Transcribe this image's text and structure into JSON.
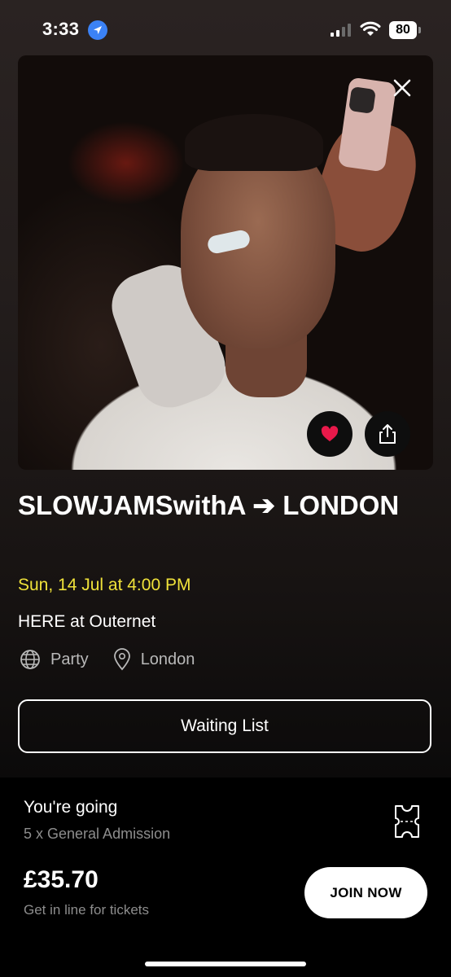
{
  "status_bar": {
    "time": "3:33",
    "battery": "80"
  },
  "event": {
    "title": "SLOWJAMSwithA ➔ LONDON",
    "datetime": "Sun, 14 Jul at 4:00 PM",
    "venue": "HERE at Outernet",
    "category": "Party",
    "location": "London"
  },
  "actions": {
    "waiting_list_label": "Waiting List"
  },
  "booking": {
    "status": "You're going",
    "tickets": "5 x General Admission",
    "price": "£35.70",
    "subline": "Get in line for tickets",
    "join_label": "JOIN NOW"
  },
  "colors": {
    "date_accent": "#f0e23a",
    "heart": "#e8194a"
  },
  "icons": {
    "close": "close-icon",
    "heart": "heart-icon",
    "share": "share-icon",
    "globe": "globe-icon",
    "pin": "location-pin-icon",
    "ticket": "ticket-icon"
  }
}
